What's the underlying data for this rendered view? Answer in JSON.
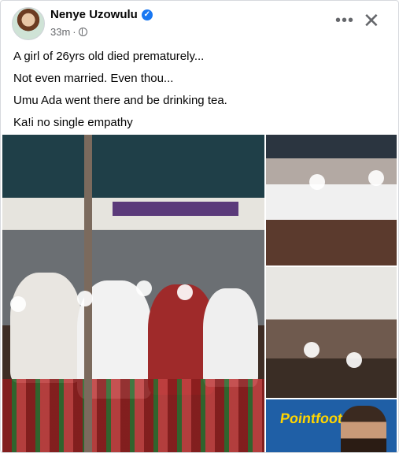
{
  "post": {
    "author": "Nenye Uzowulu",
    "time": "33m",
    "visibility_icon": "globe-icon",
    "more_icon_label": "•••",
    "close_icon_label": "✕",
    "text_lines": [
      "A girl of 26yrs old died prematurely...",
      "Not even married. Even thou...",
      "Umu Ada went there and be drinking tea.",
      "Ka!i no single empathy"
    ]
  },
  "photos": {
    "sign_text": "Pointfoot EXIT"
  },
  "colors": {
    "verified_blue": "#1877f2",
    "meta_gray": "#65676b"
  }
}
